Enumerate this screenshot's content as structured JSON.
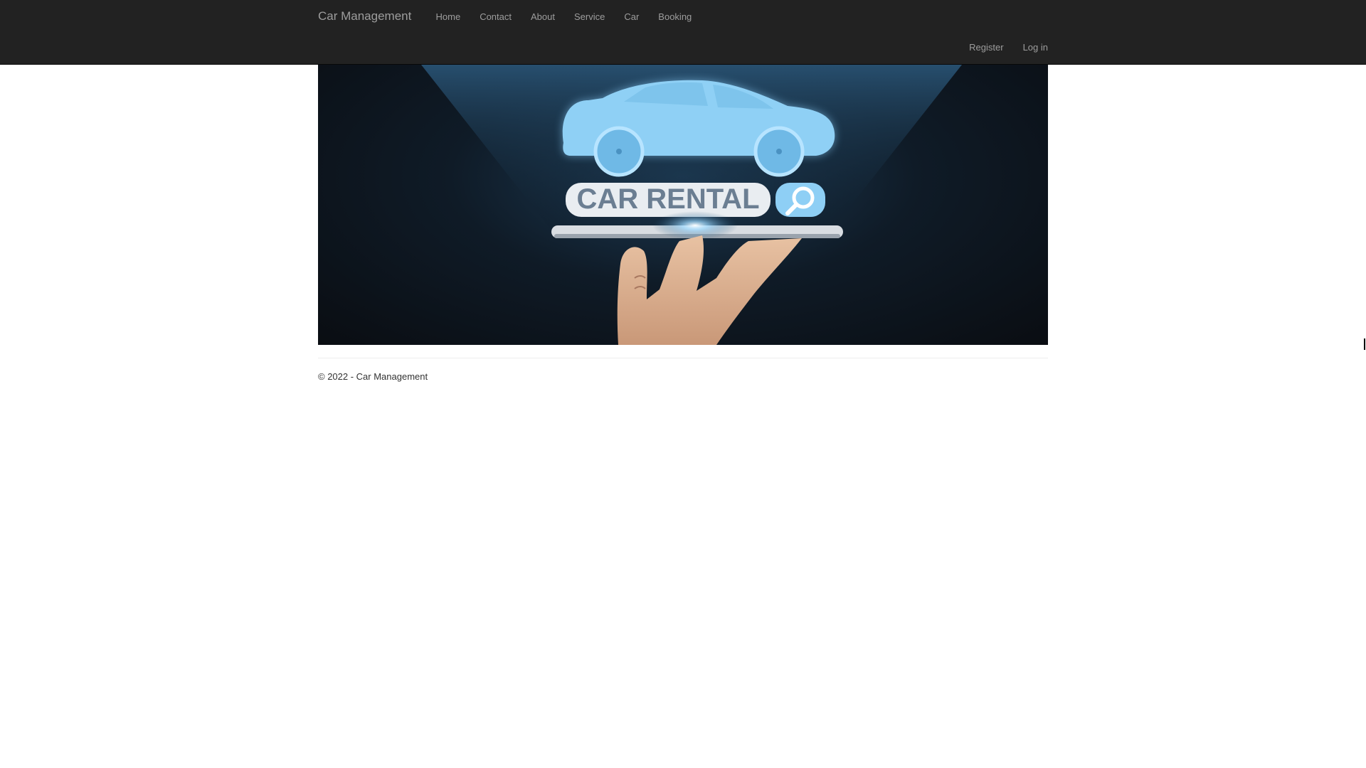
{
  "navbar": {
    "brand": "Car Management",
    "links": [
      "Home",
      "Contact",
      "About",
      "Service",
      "Car",
      "Booking"
    ],
    "right_links": [
      "Register",
      "Log in"
    ]
  },
  "hero": {
    "banner_text": "CAR RENTAL",
    "search_icon": "search-icon"
  },
  "footer": {
    "text": "© 2022 - Car Management"
  },
  "colors": {
    "navbar_bg": "#222222",
    "nav_text": "#9d9d9d",
    "hero_glow": "#8fd3ff"
  }
}
